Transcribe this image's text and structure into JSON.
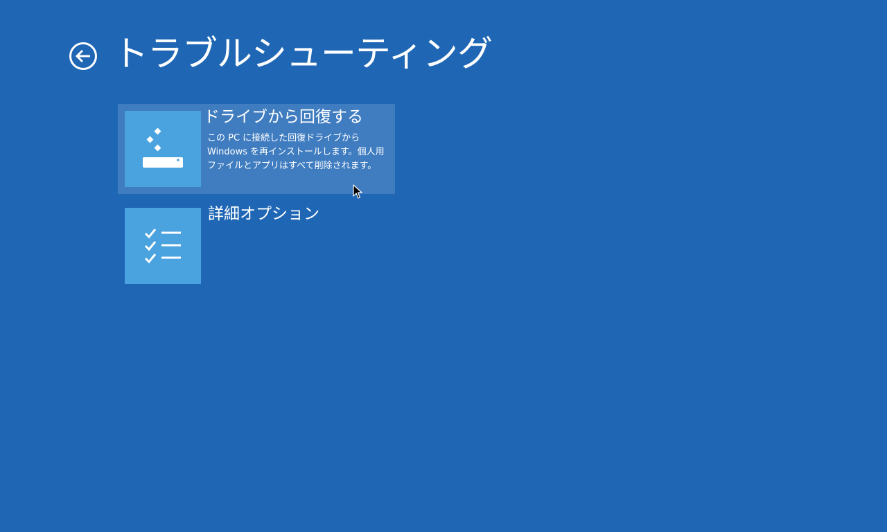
{
  "header": {
    "title": "トラブルシューティング",
    "back_icon": "back-arrow-circle-icon"
  },
  "colors": {
    "background": "#1f67b5",
    "selected_option": "#3f7cc0",
    "tile": "#4aa3df",
    "text": "#ffffff"
  },
  "options": [
    {
      "title": "ドライブから回復する",
      "icon": "recovery-drive-icon",
      "selected": true,
      "description": [
        "この PC に接続した回復ドライブから",
        "Windows を再インストールします。個人用",
        "ファイルとアプリはすべて削除されます。"
      ]
    },
    {
      "title": "詳細オプション",
      "icon": "checklist-icon",
      "selected": false,
      "description": []
    }
  ]
}
